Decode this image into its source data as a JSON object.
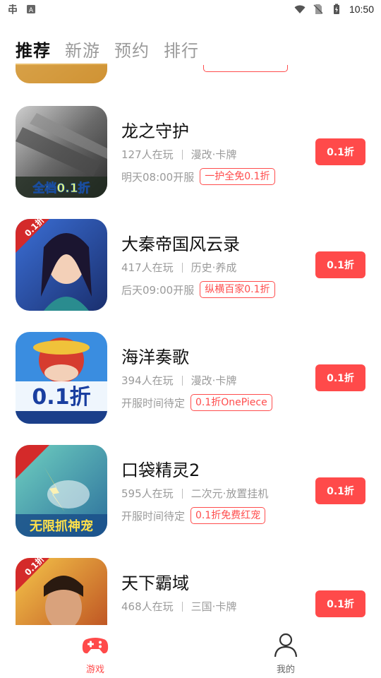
{
  "status_bar": {
    "time": "10:50",
    "icons": [
      "app-notification-icon",
      "keyboard-icon",
      "wifi-icon",
      "no-sim-icon",
      "battery-charging-icon"
    ]
  },
  "tabs": [
    {
      "label": "推荐",
      "active": true
    },
    {
      "label": "新游",
      "active": false
    },
    {
      "label": "预约",
      "active": false
    },
    {
      "label": "排行",
      "active": false
    }
  ],
  "games": [
    {
      "title": "龙之守护",
      "players": "127人在玩",
      "genre": "漫改·卡牌",
      "open_time": "明天08:00开服",
      "tag": "一护全免0.1折",
      "button": "0.1折",
      "thumb_text": "全档0.1折"
    },
    {
      "title": "大秦帝国风云录",
      "players": "417人在玩",
      "genre": "历史·养成",
      "open_time": "后天09:00开服",
      "tag": "纵横百家0.1折",
      "button": "0.1折",
      "thumb_text": "0.1折"
    },
    {
      "title": "海洋奏歌",
      "players": "394人在玩",
      "genre": "漫改·卡牌",
      "open_time": "开服时间待定",
      "tag": "0.1折OnePiece",
      "button": "0.1折",
      "thumb_text": "0.1折"
    },
    {
      "title": "口袋精灵2",
      "players": "595人在玩",
      "genre": "二次元·放置挂机",
      "open_time": "开服时间待定",
      "tag": "0.1折免费红宠",
      "button": "0.1折",
      "thumb_text": "无限抓神宠"
    },
    {
      "title": "天下霸域",
      "players": "468人在玩",
      "genre": "三国·卡牌",
      "open_time": "",
      "tag": "",
      "button": "0.1折",
      "thumb_text": "0.1折"
    }
  ],
  "bottom_nav": [
    {
      "label": "游戏",
      "active": true
    },
    {
      "label": "我的",
      "active": false
    }
  ],
  "colors": {
    "accent": "#ff4a4a",
    "muted": "#9a9a9a"
  }
}
